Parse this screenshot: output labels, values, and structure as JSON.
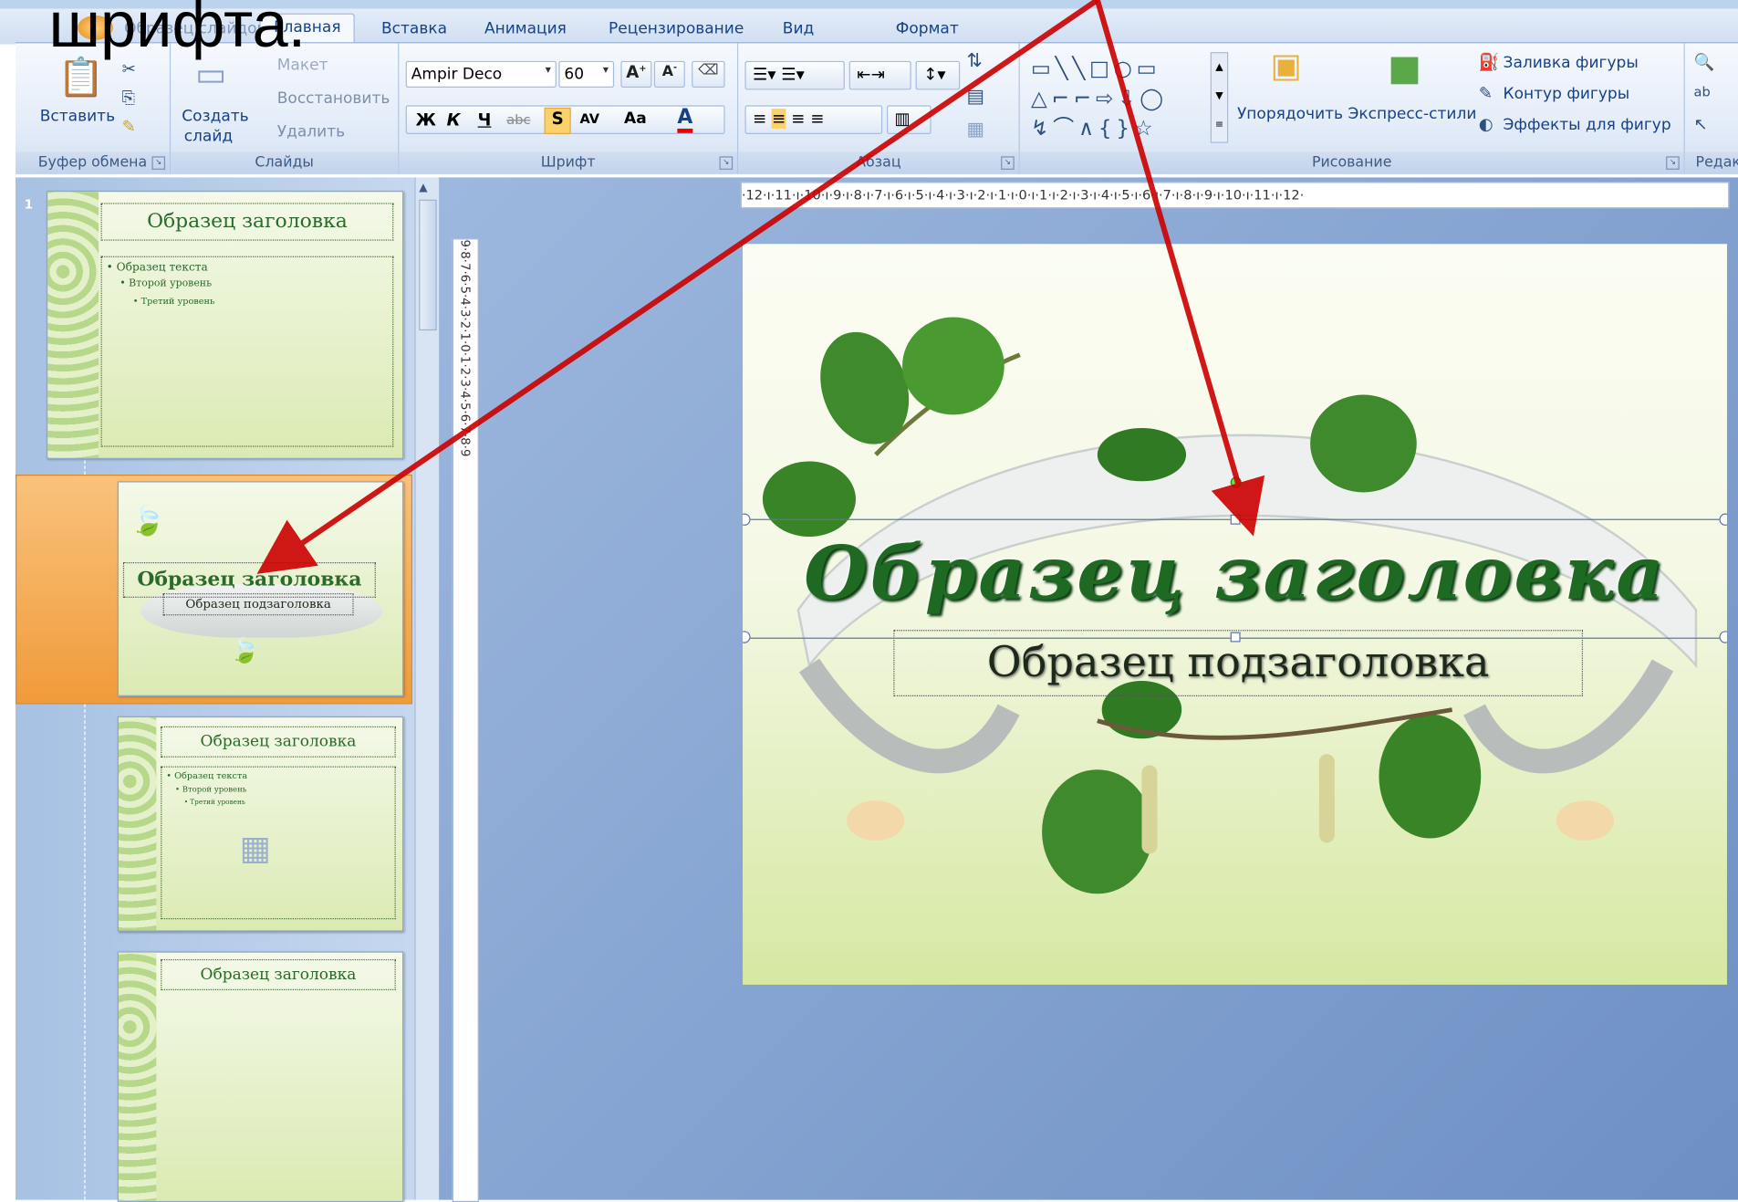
{
  "overlay": {
    "caption": "шрифта."
  },
  "tabs": [
    {
      "label": "Главная"
    },
    {
      "label": "Вставка"
    },
    {
      "label": "Анимация"
    },
    {
      "label": "Рецензирование"
    },
    {
      "label": "Вид"
    },
    {
      "label": "Формат"
    }
  ],
  "ribbon": {
    "clipboard": {
      "paste_label": "Вставить",
      "group_label": "Буфер обмена"
    },
    "slides": {
      "new_slide_label1": "Создать",
      "new_slide_label2": "слайд",
      "layout_label": "Макет",
      "reset_label": "Восстановить",
      "delete_label": "Удалить",
      "group_label": "Слайды"
    },
    "font": {
      "font_name": "Ampir Deco",
      "font_size": "60",
      "group_label": "Шрифт",
      "bold": "Ж",
      "italic": "К",
      "underline": "Ч",
      "strike": "abc",
      "shadow": "S",
      "spacing": "AV",
      "case": "Aa",
      "color": "A"
    },
    "paragraph": {
      "group_label": "Абзац"
    },
    "drawing": {
      "arrange_label": "Упорядочить",
      "quick_styles_label": "Экспресс-стили",
      "fill_label": "Заливка фигуры",
      "outline_label": "Контур фигуры",
      "effects_label": "Эффекты для фигур",
      "group_label": "Рисование"
    },
    "editing": {
      "group_label": "Редак"
    }
  },
  "thumbnails": [
    {
      "number": "1",
      "title": "Образец заголовка",
      "text1": "• Образец текста",
      "text2": "• Второй уровень",
      "text3": "• Третий уровень"
    },
    {
      "title": "Образец заголовка",
      "subtitle": "Образец подзаголовка"
    },
    {
      "title": "Образец заголовка",
      "text1": "• Образец текста",
      "text2": "• Второй уровень",
      "text3": "• Третий уровень"
    },
    {
      "title": "Образец заголовка"
    }
  ],
  "ruler": {
    "horizontal": "·12·ı·11·ı·10·ı·9·ı·8·ı·7·ı·6·ı·5·ı·4·ı·3·ı·2·ı·1·ı·0·ı·1·ı·2·ı·3·ı·4·ı·5·ı·6·ı·7·ı·8·ı·9·ı·10·ı·11·ı·12·",
    "vertical": "9·8·7·6·5·4·3·2·1·0·1·2·3·4·5·6·7·8·9"
  },
  "slide": {
    "title": "Образец заголовка",
    "subtitle": "Образец подзаголовка"
  },
  "colors": {
    "arrow": "#cc0000",
    "title_green": "#1f6a22",
    "ribbon_blue": "#15428b",
    "selection_orange": "#f19b3a"
  }
}
